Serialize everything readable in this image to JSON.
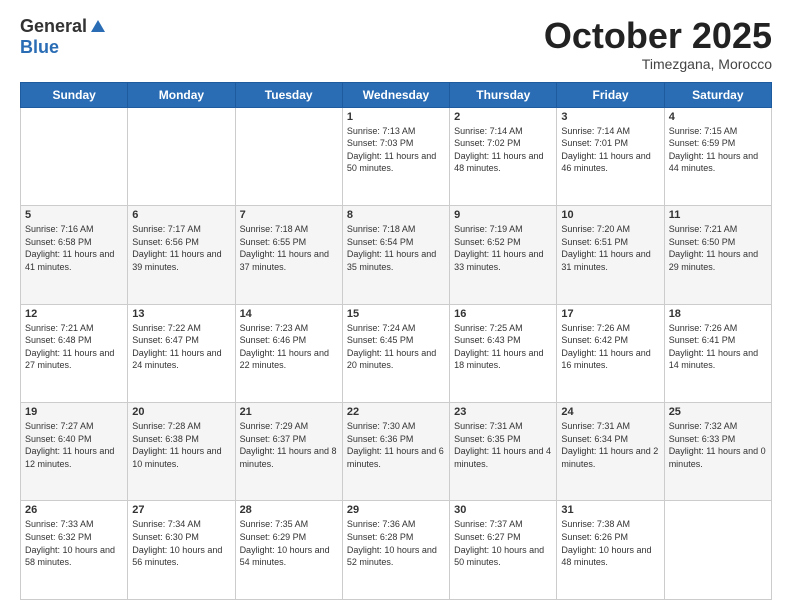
{
  "header": {
    "logo": {
      "general": "General",
      "blue": "Blue"
    },
    "title": "October 2025",
    "location": "Timezgana, Morocco"
  },
  "days_of_week": [
    "Sunday",
    "Monday",
    "Tuesday",
    "Wednesday",
    "Thursday",
    "Friday",
    "Saturday"
  ],
  "weeks": [
    [
      {
        "day": "",
        "info": ""
      },
      {
        "day": "",
        "info": ""
      },
      {
        "day": "",
        "info": ""
      },
      {
        "day": "1",
        "info": "Sunrise: 7:13 AM\nSunset: 7:03 PM\nDaylight: 11 hours and 50 minutes."
      },
      {
        "day": "2",
        "info": "Sunrise: 7:14 AM\nSunset: 7:02 PM\nDaylight: 11 hours and 48 minutes."
      },
      {
        "day": "3",
        "info": "Sunrise: 7:14 AM\nSunset: 7:01 PM\nDaylight: 11 hours and 46 minutes."
      },
      {
        "day": "4",
        "info": "Sunrise: 7:15 AM\nSunset: 6:59 PM\nDaylight: 11 hours and 44 minutes."
      }
    ],
    [
      {
        "day": "5",
        "info": "Sunrise: 7:16 AM\nSunset: 6:58 PM\nDaylight: 11 hours and 41 minutes."
      },
      {
        "day": "6",
        "info": "Sunrise: 7:17 AM\nSunset: 6:56 PM\nDaylight: 11 hours and 39 minutes."
      },
      {
        "day": "7",
        "info": "Sunrise: 7:18 AM\nSunset: 6:55 PM\nDaylight: 11 hours and 37 minutes."
      },
      {
        "day": "8",
        "info": "Sunrise: 7:18 AM\nSunset: 6:54 PM\nDaylight: 11 hours and 35 minutes."
      },
      {
        "day": "9",
        "info": "Sunrise: 7:19 AM\nSunset: 6:52 PM\nDaylight: 11 hours and 33 minutes."
      },
      {
        "day": "10",
        "info": "Sunrise: 7:20 AM\nSunset: 6:51 PM\nDaylight: 11 hours and 31 minutes."
      },
      {
        "day": "11",
        "info": "Sunrise: 7:21 AM\nSunset: 6:50 PM\nDaylight: 11 hours and 29 minutes."
      }
    ],
    [
      {
        "day": "12",
        "info": "Sunrise: 7:21 AM\nSunset: 6:48 PM\nDaylight: 11 hours and 27 minutes."
      },
      {
        "day": "13",
        "info": "Sunrise: 7:22 AM\nSunset: 6:47 PM\nDaylight: 11 hours and 24 minutes."
      },
      {
        "day": "14",
        "info": "Sunrise: 7:23 AM\nSunset: 6:46 PM\nDaylight: 11 hours and 22 minutes."
      },
      {
        "day": "15",
        "info": "Sunrise: 7:24 AM\nSunset: 6:45 PM\nDaylight: 11 hours and 20 minutes."
      },
      {
        "day": "16",
        "info": "Sunrise: 7:25 AM\nSunset: 6:43 PM\nDaylight: 11 hours and 18 minutes."
      },
      {
        "day": "17",
        "info": "Sunrise: 7:26 AM\nSunset: 6:42 PM\nDaylight: 11 hours and 16 minutes."
      },
      {
        "day": "18",
        "info": "Sunrise: 7:26 AM\nSunset: 6:41 PM\nDaylight: 11 hours and 14 minutes."
      }
    ],
    [
      {
        "day": "19",
        "info": "Sunrise: 7:27 AM\nSunset: 6:40 PM\nDaylight: 11 hours and 12 minutes."
      },
      {
        "day": "20",
        "info": "Sunrise: 7:28 AM\nSunset: 6:38 PM\nDaylight: 11 hours and 10 minutes."
      },
      {
        "day": "21",
        "info": "Sunrise: 7:29 AM\nSunset: 6:37 PM\nDaylight: 11 hours and 8 minutes."
      },
      {
        "day": "22",
        "info": "Sunrise: 7:30 AM\nSunset: 6:36 PM\nDaylight: 11 hours and 6 minutes."
      },
      {
        "day": "23",
        "info": "Sunrise: 7:31 AM\nSunset: 6:35 PM\nDaylight: 11 hours and 4 minutes."
      },
      {
        "day": "24",
        "info": "Sunrise: 7:31 AM\nSunset: 6:34 PM\nDaylight: 11 hours and 2 minutes."
      },
      {
        "day": "25",
        "info": "Sunrise: 7:32 AM\nSunset: 6:33 PM\nDaylight: 11 hours and 0 minutes."
      }
    ],
    [
      {
        "day": "26",
        "info": "Sunrise: 7:33 AM\nSunset: 6:32 PM\nDaylight: 10 hours and 58 minutes."
      },
      {
        "day": "27",
        "info": "Sunrise: 7:34 AM\nSunset: 6:30 PM\nDaylight: 10 hours and 56 minutes."
      },
      {
        "day": "28",
        "info": "Sunrise: 7:35 AM\nSunset: 6:29 PM\nDaylight: 10 hours and 54 minutes."
      },
      {
        "day": "29",
        "info": "Sunrise: 7:36 AM\nSunset: 6:28 PM\nDaylight: 10 hours and 52 minutes."
      },
      {
        "day": "30",
        "info": "Sunrise: 7:37 AM\nSunset: 6:27 PM\nDaylight: 10 hours and 50 minutes."
      },
      {
        "day": "31",
        "info": "Sunrise: 7:38 AM\nSunset: 6:26 PM\nDaylight: 10 hours and 48 minutes."
      },
      {
        "day": "",
        "info": ""
      }
    ]
  ]
}
